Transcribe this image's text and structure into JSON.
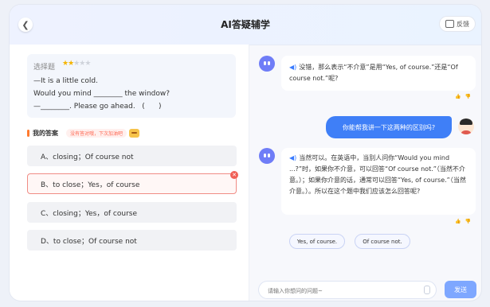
{
  "header": {
    "title": "AI答疑辅学",
    "back_icon": "chevron-left-icon",
    "feedback_label": "反馈",
    "feedback_icon": "message-square-icon"
  },
  "question": {
    "type_label": "选择题",
    "difficulty_stars": 2,
    "difficulty_max": 5,
    "lines": [
      "—It is a little cold.",
      "Would you mind ________ the window?",
      "—________. Please go ahead.   (      )"
    ]
  },
  "my_answer": {
    "label": "我的答案",
    "hint": "没有答对哦，下次加油吧"
  },
  "options": [
    {
      "label": "A、closing；Of course not",
      "state": "normal"
    },
    {
      "label": "B、to close；Yes，of course",
      "state": "wrong"
    },
    {
      "label": "C、closing；Yes，of course",
      "state": "normal"
    },
    {
      "label": "D、to close；Of course not",
      "state": "normal"
    }
  ],
  "chat": {
    "ai_msg_1": "没错，那么表示“不介意”是用“Yes, of course.”还是“Of course not.”呢?",
    "user_msg": "你能帮我讲一下这两种的区别吗?",
    "ai_msg_2": "当然可以。在英语中，当别人问你“Would you mind ...?”时，如果你不介意，可以回答“Of course not.”（当然不介意。）；如果你介意的话，通常可以回答“Yes, of course.”（当然介意。）。所以在这个题中我们应该怎么回答呢?",
    "suggestions": [
      "Yes, of course.",
      "Of course not."
    ]
  },
  "input": {
    "placeholder": "请输入你想问的问题~",
    "send_label": "发送"
  },
  "colors": {
    "accent": "#3f7ff7",
    "wrong": "#f06056",
    "star": "#f5b400",
    "ai_avatar": "#6f7df7"
  }
}
